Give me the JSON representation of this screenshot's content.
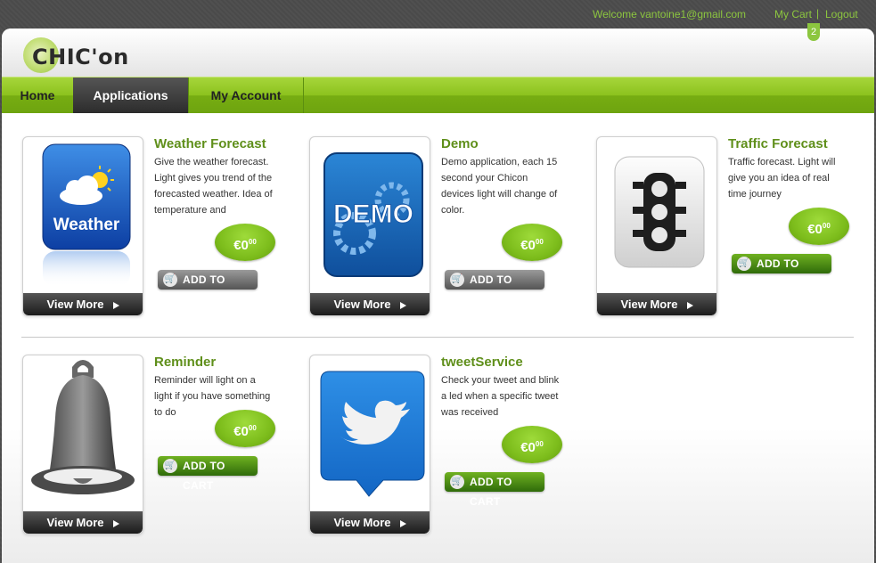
{
  "topbar": {
    "welcome": "Welcome vantoine1@gmail.com",
    "my_cart": "My Cart",
    "separator": "|",
    "logout": "Logout",
    "cart_count": "2"
  },
  "logo": {
    "text": "CHIC'on"
  },
  "nav": {
    "items": [
      {
        "label": "Home"
      },
      {
        "label": "Applications"
      },
      {
        "label": "My Account"
      }
    ],
    "active": "Applications"
  },
  "apps": [
    {
      "title": "Weather Forecast",
      "description": "Give the weather forecast. Light gives you trend of the forecasted weather. Idea of temperature and",
      "price": "€0",
      "price_cents": "00",
      "add_to_cart": "ADD TO CART",
      "view_more": "View More",
      "icon": "weather-icon",
      "icon_text": "Weather",
      "button_state": "grey"
    },
    {
      "title": "Demo",
      "description": "Demo application, each 15 second your Chicon devices light will change of color.",
      "price": "€0",
      "price_cents": "00",
      "add_to_cart": "ADD TO CART",
      "view_more": "View More",
      "icon": "demo-gear-icon",
      "icon_text": "DEMO",
      "button_state": "grey"
    },
    {
      "title": "Traffic Forecast",
      "description": "Traffic forecast. Light will give you an idea of real time journey",
      "price": "€0",
      "price_cents": "00",
      "add_to_cart": "ADD TO CART",
      "view_more": "View More",
      "icon": "traffic-light-icon",
      "button_state": "green"
    },
    {
      "title": "Reminder",
      "description": "Reminder will light on a light if you have something to do",
      "price": "€0",
      "price_cents": "00",
      "add_to_cart": "ADD TO CART",
      "view_more": "View More",
      "icon": "bell-icon",
      "button_state": "green"
    },
    {
      "title": "tweetService",
      "description": "Check your tweet and blink a led when a specific tweet was received",
      "price": "€0",
      "price_cents": "00",
      "add_to_cart": "ADD TO CART",
      "view_more": "View More",
      "icon": "twitter-bird-icon",
      "button_state": "green"
    }
  ],
  "colors": {
    "accent_green": "#8cc63f",
    "title_green": "#5f8f1a",
    "nav_active": "#2c2c2c"
  }
}
